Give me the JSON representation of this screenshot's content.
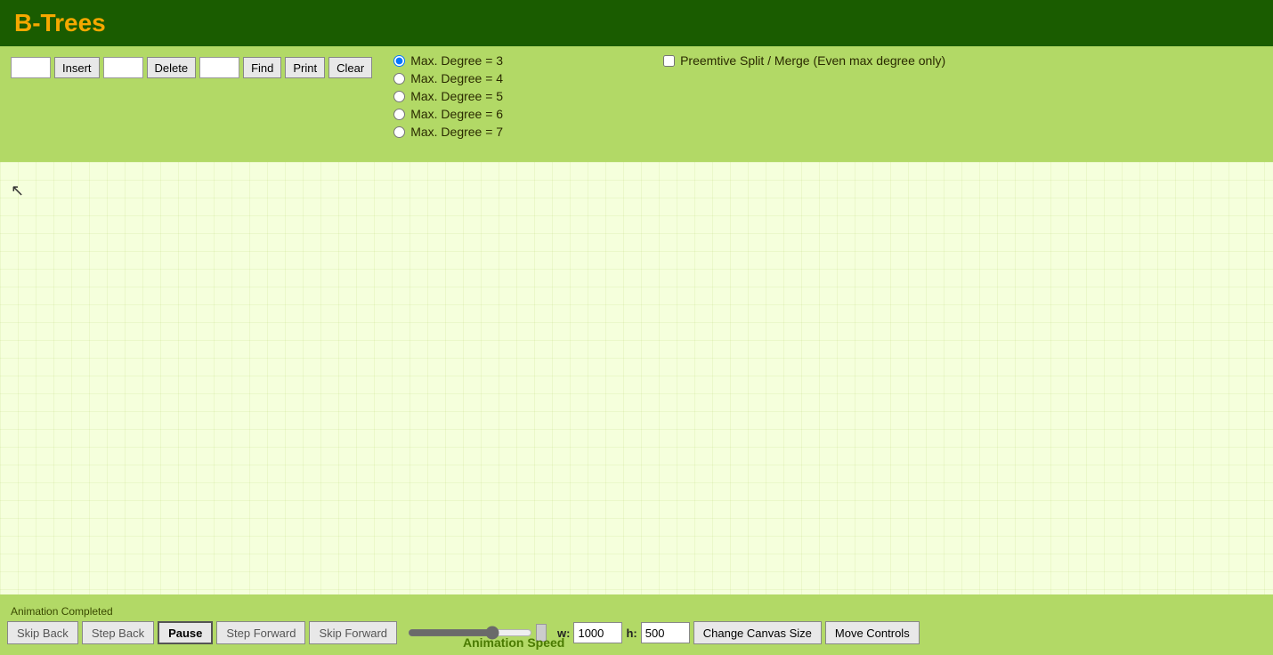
{
  "header": {
    "title": "B-Trees"
  },
  "controls": {
    "insert_label": "Insert",
    "delete_label": "Delete",
    "find_label": "Find",
    "print_label": "Print",
    "clear_label": "Clear",
    "insert_placeholder": "",
    "delete_placeholder": "",
    "find_placeholder": ""
  },
  "degrees": [
    {
      "label": "Max. Degree = 3",
      "value": "3",
      "checked": true
    },
    {
      "label": "Max. Degree = 4",
      "value": "4",
      "checked": false
    },
    {
      "label": "Max. Degree = 5",
      "value": "5",
      "checked": false
    },
    {
      "label": "Max. Degree = 6",
      "value": "6",
      "checked": false
    },
    {
      "label": "Max. Degree = 7",
      "value": "7",
      "checked": false
    }
  ],
  "preemptive": {
    "label": "Preemtive Split / Merge (Even max degree only)",
    "checked": false
  },
  "bottom_bar": {
    "animation_completed": "Animation Completed",
    "skip_back_label": "Skip Back",
    "step_back_label": "Step Back",
    "pause_label": "Pause",
    "step_forward_label": "Step Forward",
    "skip_forward_label": "Skip Forward",
    "animation_speed_label": "Animation Speed",
    "w_label": "w:",
    "h_label": "h:",
    "w_value": "1000",
    "h_value": "500",
    "change_canvas_label": "Change Canvas Size",
    "move_controls_label": "Move Controls"
  }
}
